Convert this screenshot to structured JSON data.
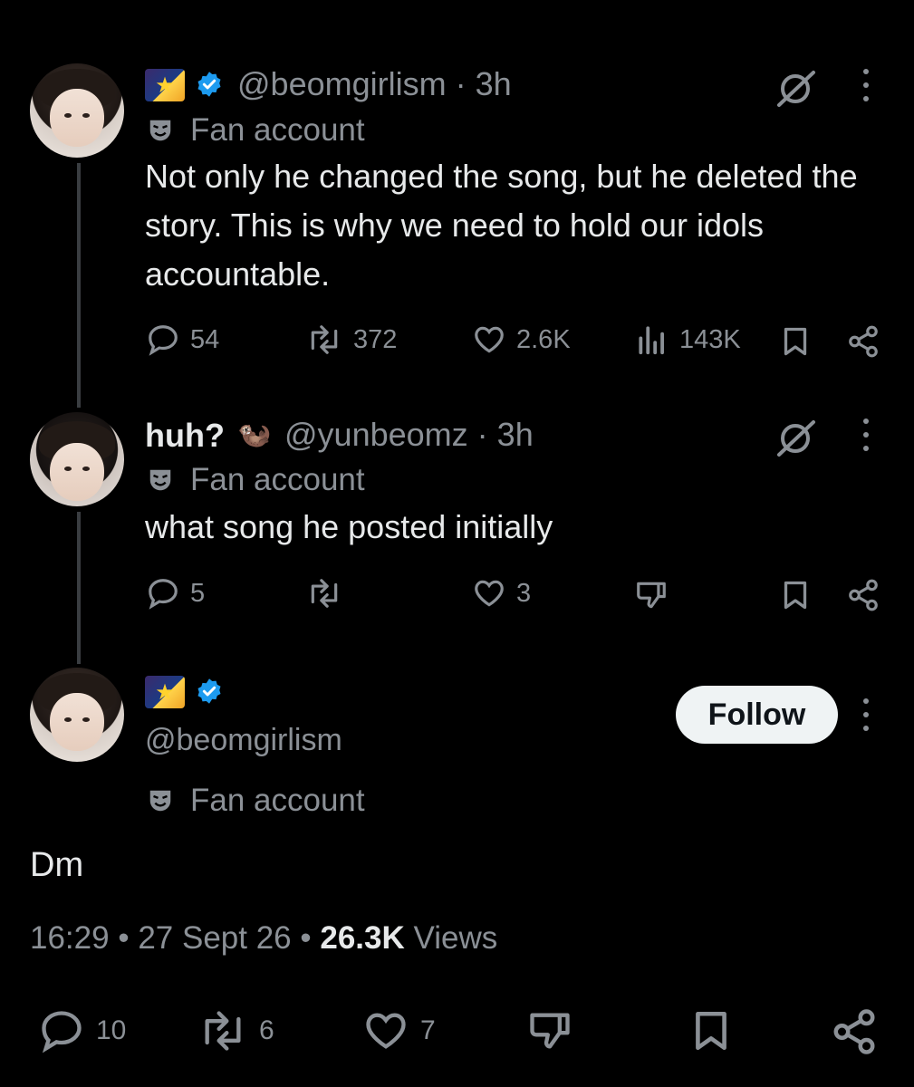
{
  "thread": [
    {
      "handle": "@beomgirlism",
      "time_sep": "·",
      "time": "3h",
      "label": "Fan account",
      "text": "Not only he changed the song, but he deleted the story. This is why we need to hold our idols accountable.",
      "stats": {
        "replies": "54",
        "reposts": "372",
        "likes": "2.6K",
        "views": "143K"
      }
    },
    {
      "name": "huh?",
      "handle": "@yunbeomz",
      "time_sep": "·",
      "time": "3h",
      "label": "Fan account",
      "text": "what song he posted initially",
      "stats": {
        "replies": "5",
        "likes": "3"
      }
    }
  ],
  "main_post": {
    "handle": "@beomgirlism",
    "follow_label": "Follow",
    "label": "Fan account",
    "text": "Dm",
    "time": "16:29",
    "sep1": "•",
    "date": "27 Sept 26",
    "sep2": "•",
    "views_count": "26.3K",
    "views_label": "Views",
    "stats": {
      "replies": "10",
      "reposts": "6",
      "likes": "7"
    }
  },
  "colors": {
    "background": "#000000",
    "text": "#e7e9ea",
    "muted": "#8b9096",
    "verified": "#1d9bf0",
    "follow_bg": "#eff3f4"
  },
  "icons": [
    "reply-icon",
    "repost-icon",
    "like-icon",
    "views-icon",
    "bookmark-icon",
    "share-icon",
    "grok-icon",
    "more-icon",
    "dislike-icon",
    "verified-icon",
    "mask-icon"
  ]
}
